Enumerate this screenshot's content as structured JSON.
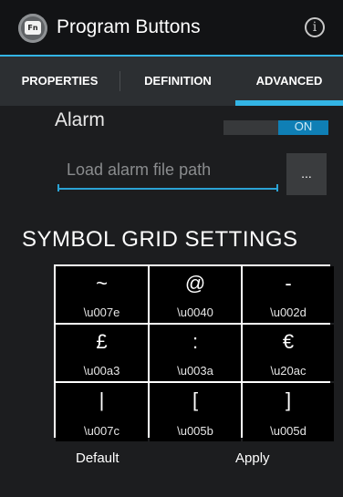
{
  "appbar": {
    "title": "Program Buttons",
    "app_icon_text": "Fn",
    "info_glyph": "i"
  },
  "tabs": [
    {
      "label": "PROPERTIES",
      "selected": false
    },
    {
      "label": "DEFINITION",
      "selected": false
    },
    {
      "label": "ADVANCED",
      "selected": true
    }
  ],
  "alarm": {
    "label": "Alarm",
    "toggle_text": "ON",
    "path_placeholder": "Load alarm file path",
    "path_value": "",
    "browse_label": "..."
  },
  "symbol_grid": {
    "title": "SYMBOL GRID SETTINGS",
    "cells": [
      {
        "symbol": "~",
        "code": "\\u007e"
      },
      {
        "symbol": "@",
        "code": "\\u0040"
      },
      {
        "symbol": "-",
        "code": "\\u002d"
      },
      {
        "symbol": "£",
        "code": "\\u00a3"
      },
      {
        "symbol": ":",
        "code": "\\u003a"
      },
      {
        "symbol": "€",
        "code": "\\u20ac"
      },
      {
        "symbol": "|",
        "code": "\\u007c"
      },
      {
        "symbol": "[",
        "code": "\\u005b"
      },
      {
        "symbol": "]",
        "code": "\\u005d"
      }
    ]
  },
  "actions": {
    "default_label": "Default",
    "apply_label": "Apply"
  },
  "colors": {
    "accent": "#33b5e5",
    "toggle_on": "#0f7fb5"
  }
}
